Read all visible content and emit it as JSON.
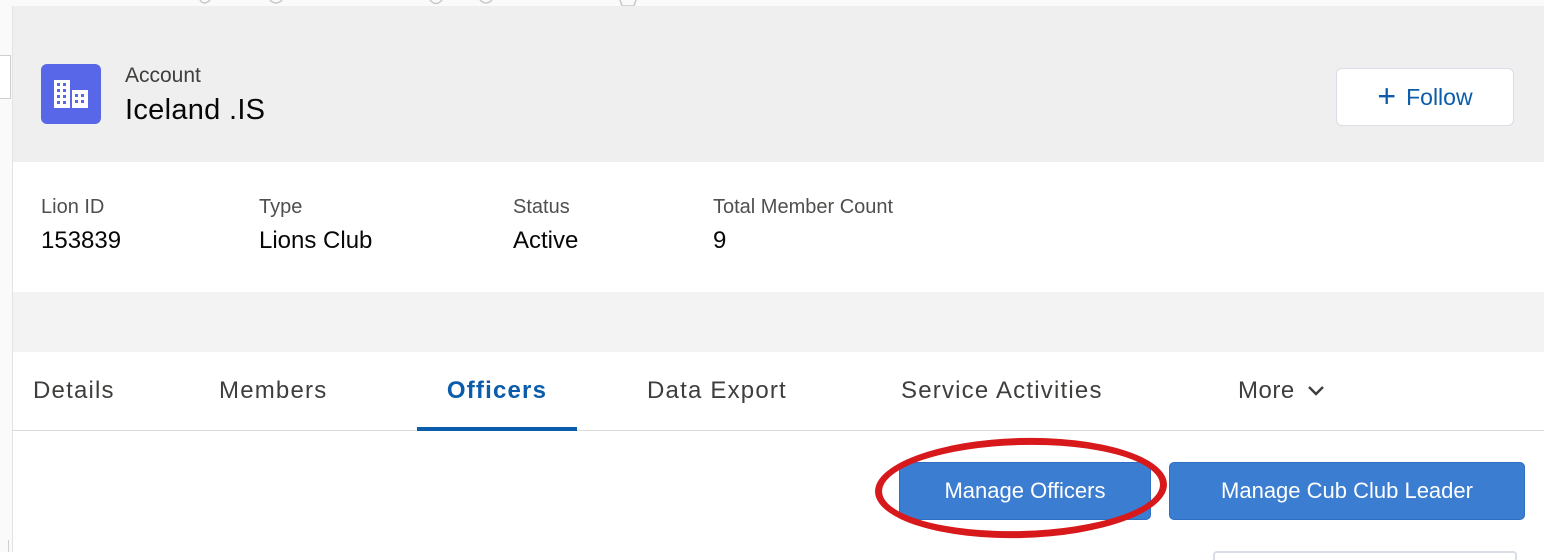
{
  "header": {
    "object_label": "Account",
    "record_title": "Iceland .IS",
    "icon": "account-building-icon",
    "icon_color": "#5867e8",
    "follow_label": "Follow"
  },
  "highlights": [
    {
      "label": "Lion ID",
      "value": "153839"
    },
    {
      "label": "Type",
      "value": "Lions Club"
    },
    {
      "label": "Status",
      "value": "Active"
    },
    {
      "label": "Total Member Count",
      "value": "9"
    }
  ],
  "tabs": [
    {
      "label": "Details",
      "active": false
    },
    {
      "label": "Members",
      "active": false
    },
    {
      "label": "Officers",
      "active": true
    },
    {
      "label": "Data Export",
      "active": false
    },
    {
      "label": "Service Activities",
      "active": false
    },
    {
      "label": "More",
      "active": false
    }
  ],
  "actions": {
    "manage_officers": "Manage Officers",
    "manage_cub_club_leader": "Manage Cub Club Leader"
  },
  "colors": {
    "brand_blue": "#0b5cab",
    "button_blue": "#3b7dd0",
    "annotation_red": "#d7191c"
  }
}
